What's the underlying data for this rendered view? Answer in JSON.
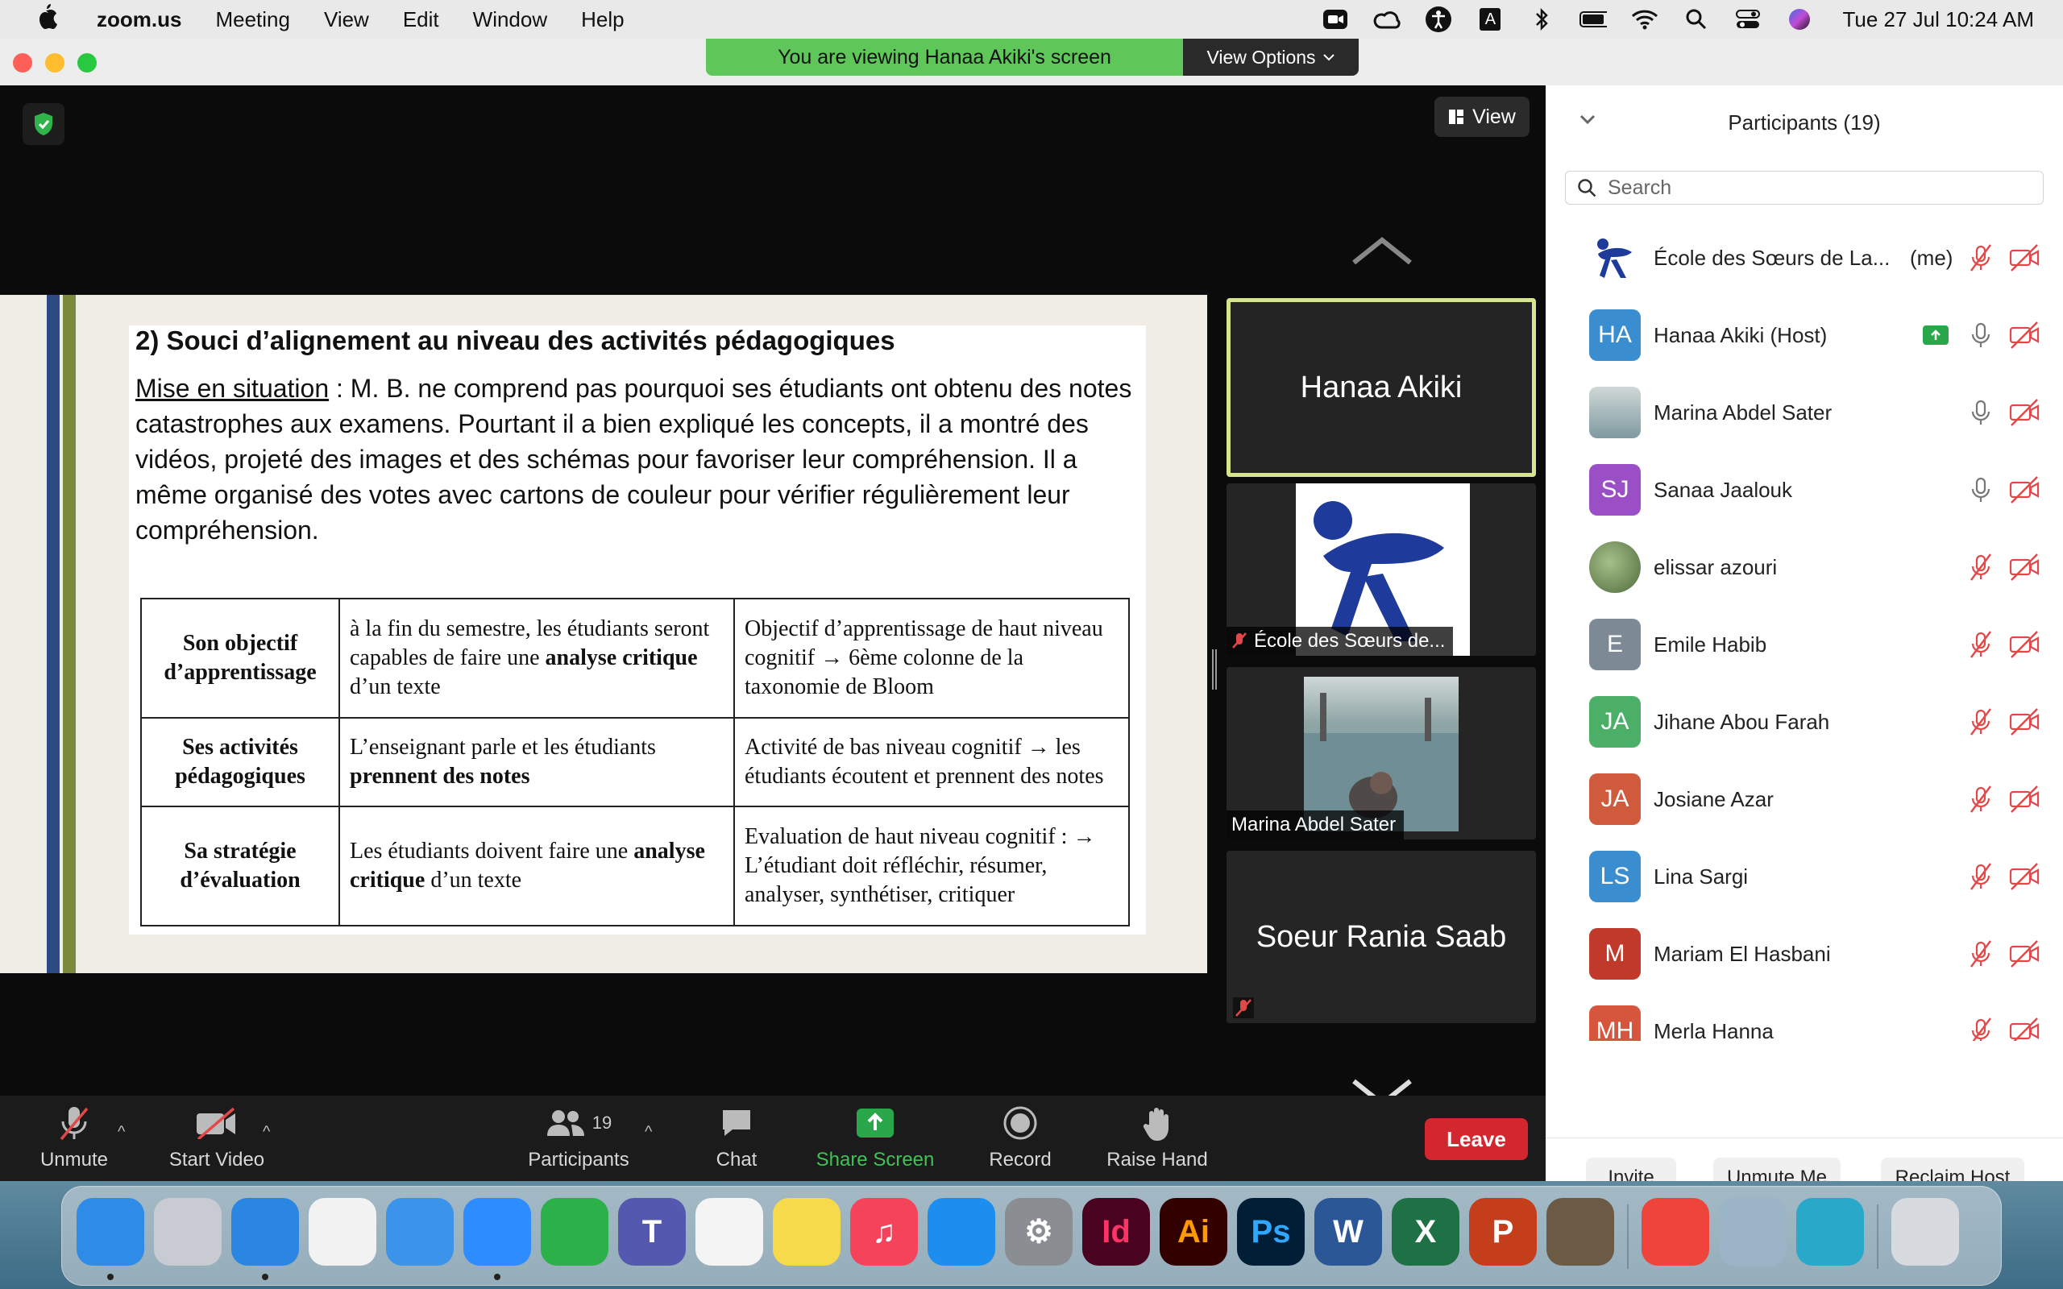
{
  "menubar": {
    "app_name": "zoom.us",
    "menus": [
      "Meeting",
      "View",
      "Edit",
      "Window",
      "Help"
    ],
    "clock": "Tue 27 Jul  10:24 AM",
    "status_icons": [
      "zoom-icon",
      "creative-cloud-icon",
      "accessibility-icon",
      "input-source-icon",
      "bluetooth-icon",
      "battery-icon",
      "wifi-icon",
      "search-icon",
      "control-center-icon",
      "siri-icon"
    ],
    "input_source_label": "A"
  },
  "window": {
    "viewing_banner": "You are viewing Hanaa Akiki's screen",
    "view_options": "View Options",
    "view_button": "View"
  },
  "slide": {
    "title": "2) Souci d’alignement au niveau des activités pédagogiques",
    "situation_label": "Mise en situation",
    "situation_text": " : M. B. ne comprend pas pourquoi ses étudiants ont obtenu des notes catastrophes aux examens. Pourtant il a bien expliqué les concepts, il a montré des vidéos, projeté des images et des schémas pour favoriser leur compréhension. Il a même organisé des votes avec cartons de couleur pour vérifier régulièrement leur compréhension.",
    "rows": [
      {
        "head": "Son objectif d’apprentissage",
        "mid_pre": "à la fin du semestre, les étudiants seront capables de faire une ",
        "mid_bold": "analyse critique",
        "mid_post": " d’un texte",
        "right": "Objectif d’apprentissage de haut niveau cognitif → 6ème colonne de la taxonomie de Bloom"
      },
      {
        "head": "Ses activités pédagogiques",
        "mid_pre": "L’enseignant parle et les étudiants ",
        "mid_bold": "prennent des notes",
        "mid_post": "",
        "right": "Activité de bas niveau cognitif → les étudiants écoutent et prennent des notes"
      },
      {
        "head": "Sa stratégie d’évaluation",
        "mid_pre": "Les étudiants doivent faire une ",
        "mid_bold": "analyse critique",
        "mid_post": " d’un texte",
        "right": "Evaluation de haut niveau cognitif : → L’étudiant doit réfléchir, résumer, analyser, synthétiser, critiquer"
      }
    ]
  },
  "gallery": {
    "tiles": [
      {
        "name": "Hanaa Akiki"
      },
      {
        "name": "École des Sœurs de..."
      },
      {
        "name": "Marina Abdel Sater"
      },
      {
        "name": "Soeur Rania Saab"
      }
    ]
  },
  "toolbar": {
    "unmute": "Unmute",
    "start_video": "Start Video",
    "participants": "Participants",
    "participants_count": "19",
    "chat": "Chat",
    "share_screen": "Share Screen",
    "record": "Record",
    "raise_hand": "Raise Hand",
    "leave": "Leave"
  },
  "panel": {
    "title": "Participants (19)",
    "search_placeholder": "Search",
    "participants": [
      {
        "name": "École des Sœurs de La...",
        "suffix": "(me)",
        "initials": "",
        "color": "",
        "mic": "muted",
        "sharing": false
      },
      {
        "name": "Hanaa Akiki (Host)",
        "suffix": "",
        "initials": "HA",
        "color": "#3a8ed0",
        "mic": "on",
        "sharing": true
      },
      {
        "name": "Marina Abdel Sater",
        "suffix": "",
        "initials": "",
        "color": "",
        "mic": "on",
        "sharing": false
      },
      {
        "name": "Sanaa Jaalouk",
        "suffix": "",
        "initials": "SJ",
        "color": "#9b4fc6",
        "mic": "on",
        "sharing": false
      },
      {
        "name": "elissar azouri",
        "suffix": "",
        "initials": "",
        "color": "",
        "mic": "muted",
        "sharing": false
      },
      {
        "name": "Emile Habib",
        "suffix": "",
        "initials": "E",
        "color": "#7d8a96",
        "mic": "muted",
        "sharing": false
      },
      {
        "name": "Jihane Abou Farah",
        "suffix": "",
        "initials": "JA",
        "color": "#4caf68",
        "mic": "muted",
        "sharing": false
      },
      {
        "name": "Josiane Azar",
        "suffix": "",
        "initials": "JA",
        "color": "#cf5a3c",
        "mic": "muted",
        "sharing": false
      },
      {
        "name": "Lina Sargi",
        "suffix": "",
        "initials": "LS",
        "color": "#3a8ed0",
        "mic": "muted",
        "sharing": false
      },
      {
        "name": "Mariam El Hasbani",
        "suffix": "",
        "initials": "M",
        "color": "#c0392b",
        "mic": "muted",
        "sharing": false
      },
      {
        "name": "Merla Hanna",
        "suffix": "",
        "initials": "MH",
        "color": "#d6553d",
        "mic": "muted",
        "sharing": false
      }
    ],
    "invite": "Invite",
    "unmute_me": "Unmute Me",
    "reclaim_host": "Reclaim Host"
  },
  "dock": {
    "apps": [
      {
        "name": "finder-icon",
        "color": "#2e8be6",
        "label": ""
      },
      {
        "name": "launchpad-icon",
        "color": "#c8ccd2",
        "label": ""
      },
      {
        "name": "safari-icon",
        "color": "#2a86e0",
        "label": ""
      },
      {
        "name": "chrome-icon",
        "color": "#f2f2f2",
        "label": ""
      },
      {
        "name": "mail-icon",
        "color": "#3b94ea",
        "label": ""
      },
      {
        "name": "zoom-icon",
        "color": "#2d8cff",
        "label": ""
      },
      {
        "name": "facetime-icon",
        "color": "#2bb04a",
        "label": ""
      },
      {
        "name": "teams-icon",
        "color": "#5558af",
        "label": "T"
      },
      {
        "name": "photos-icon",
        "color": "#f4f4f4",
        "label": ""
      },
      {
        "name": "notes-icon",
        "color": "#f7d94c",
        "label": ""
      },
      {
        "name": "music-icon",
        "color": "#f5435b",
        "label": "♫"
      },
      {
        "name": "app-store-icon",
        "color": "#1c8ef0",
        "label": ""
      },
      {
        "name": "system-preferences-icon",
        "color": "#8a8d92",
        "label": "⚙"
      },
      {
        "name": "indesign-icon",
        "color": "#49021f",
        "label": "Id"
      },
      {
        "name": "illustrator-icon",
        "color": "#330000",
        "label": "Ai"
      },
      {
        "name": "photoshop-icon",
        "color": "#001e36",
        "label": "Ps"
      },
      {
        "name": "word-icon",
        "color": "#2b5797",
        "label": "W"
      },
      {
        "name": "excel-icon",
        "color": "#1e7145",
        "label": "X"
      },
      {
        "name": "powerpoint-icon",
        "color": "#c43e1c",
        "label": "P"
      },
      {
        "name": "thinker-icon",
        "color": "#6b5a44",
        "label": ""
      },
      {
        "name": "anydesk-icon",
        "color": "#ef443b",
        "label": ""
      },
      {
        "name": "preview-icon",
        "color": "#9bb4c8",
        "label": ""
      },
      {
        "name": "accessibility-app-icon",
        "color": "#2aa8c9",
        "label": ""
      },
      {
        "name": "trash-icon",
        "color": "#d7dbe0",
        "label": ""
      }
    ]
  }
}
